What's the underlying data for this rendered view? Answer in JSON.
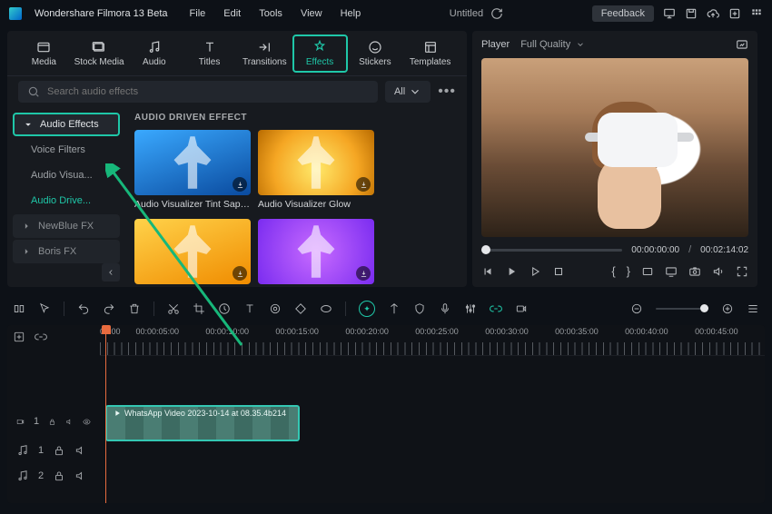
{
  "app": {
    "name": "Wondershare Filmora 13 Beta",
    "title": "Untitled"
  },
  "menu": {
    "file": "File",
    "edit": "Edit",
    "tools": "Tools",
    "view": "View",
    "help": "Help"
  },
  "titleRight": {
    "feedback": "Feedback"
  },
  "tabs": {
    "media": "Media",
    "stock": "Stock Media",
    "audio": "Audio",
    "titles": "Titles",
    "transitions": "Transitions",
    "effects": "Effects",
    "stickers": "Stickers",
    "templates": "Templates"
  },
  "search": {
    "placeholder": "Search audio effects",
    "all": "All"
  },
  "sidebar": {
    "audioEffects": "Audio Effects",
    "voiceFilters": "Voice Filters",
    "audioVisualizer": "Audio Visua...",
    "audioDriven": "Audio Drive...",
    "newblue": "NewBlue FX",
    "boris": "Boris FX"
  },
  "section": {
    "title": "AUDIO DRIVEN EFFECT"
  },
  "cards": {
    "a": "Audio Visualizer Tint Sapphire",
    "b": "Audio Visualizer Glow",
    "c": "",
    "d": ""
  },
  "preview": {
    "player": "Player",
    "quality": "Full Quality",
    "cur": "00:00:00:00",
    "total": "00:02:14:02"
  },
  "ruler": {
    "t0": "00:00",
    "t1": "00:00:05:00",
    "t2": "00:00:10:00",
    "t3": "00:00:15:00",
    "t4": "00:00:20:00",
    "t5": "00:00:25:00",
    "t6": "00:00:30:00",
    "t7": "00:00:35:00",
    "t8": "00:00:40:00",
    "t9": "00:00:45:00"
  },
  "clip": {
    "label": "WhatsApp Video 2023-10-14 at 08.35.4b214"
  },
  "tracks": {
    "v1": "1",
    "a1": "1",
    "a2": "2"
  }
}
